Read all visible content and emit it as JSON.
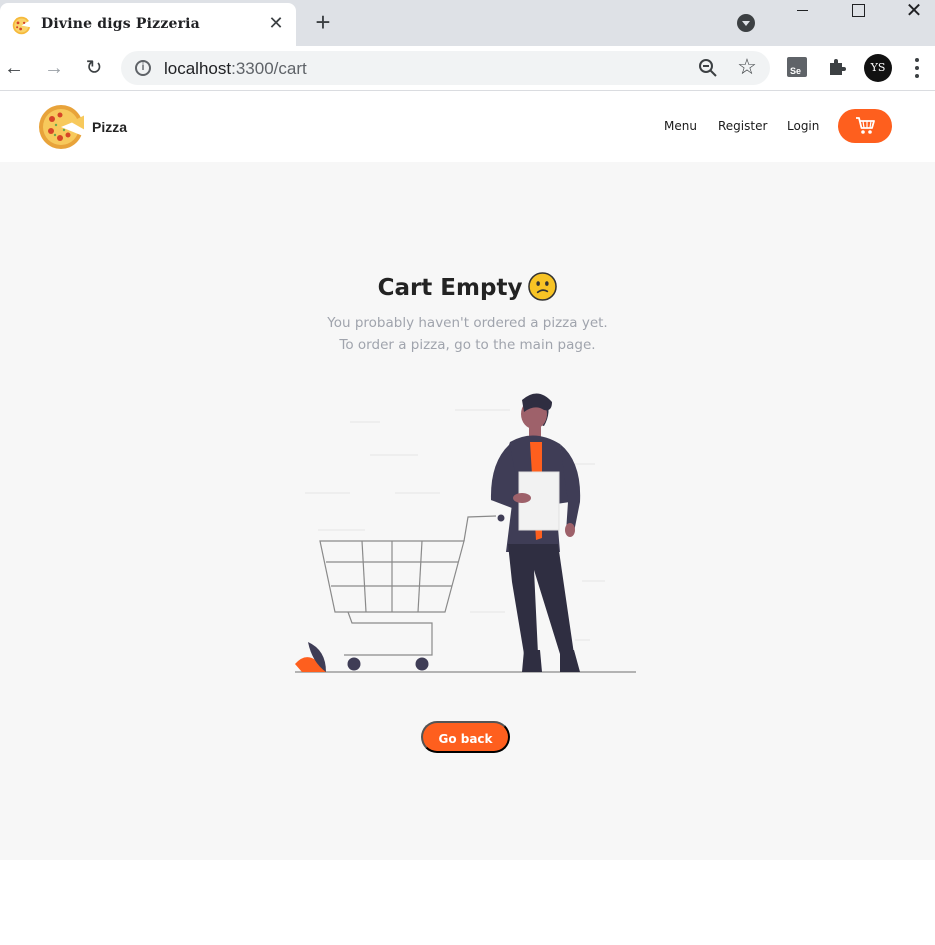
{
  "browser": {
    "tab_title": "Divine digs Pizzeria",
    "tab_close": "✕",
    "new_tab": "+",
    "url_host": "localhost",
    "url_path": ":3300/cart",
    "profile_initials": "YS",
    "extension_label": "Se"
  },
  "navbar": {
    "brand": "Pizza",
    "links": [
      {
        "label": "Menu"
      },
      {
        "label": "Register"
      },
      {
        "label": "Login"
      }
    ]
  },
  "cart": {
    "heading": "Cart Empty",
    "line1": "You probably haven't ordered a pizza yet.",
    "line2": "To order a pizza, go to the main page.",
    "button": "Go back"
  },
  "colors": {
    "accent": "#fe5f1e",
    "background": "#f7f7f7",
    "muted_text": "#a0a4ad"
  },
  "icons": [
    "pizza-icon",
    "cart-icon",
    "confused-face-icon",
    "search-zoom-icon",
    "star-icon",
    "puzzle-icon"
  ]
}
